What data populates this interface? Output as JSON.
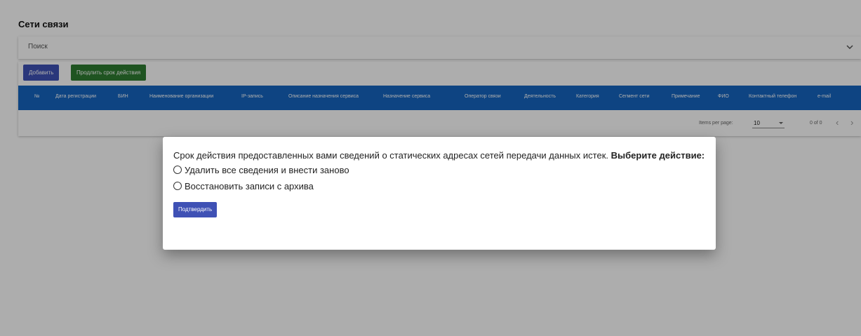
{
  "page": {
    "title": "Сети связи"
  },
  "search": {
    "label": "Поиск"
  },
  "toolbar": {
    "add_label": "Добавить",
    "extend_label": "Продлить срок действия"
  },
  "table": {
    "columns": [
      "№",
      "Дата регистрации",
      "БИН",
      "Наименование организации",
      "IP-запись",
      "Описание назначения сервиса",
      "Назначение сервиса",
      "Оператор связи",
      "Деятельность",
      "Категория",
      "Сегмент сети",
      "Примечание",
      "ФИО",
      "Контактный телефон",
      "e-mail"
    ],
    "rows": []
  },
  "paginator": {
    "items_per_page_label": "Items per page:",
    "page_size": "10",
    "range": "0 of 0"
  },
  "dialog": {
    "message": "Срок действия предоставленных вами сведений о статических адресах сетей передачи данных истек.",
    "message_bold": "Выберите действие:",
    "options": [
      "Удалить все сведения и внести заново",
      "Восстановить записи с архива"
    ],
    "confirm_label": "Подтвердить"
  },
  "colors": {
    "primary": "#3f51b5",
    "success": "#2e7d32",
    "table_header": "#1565c0"
  }
}
